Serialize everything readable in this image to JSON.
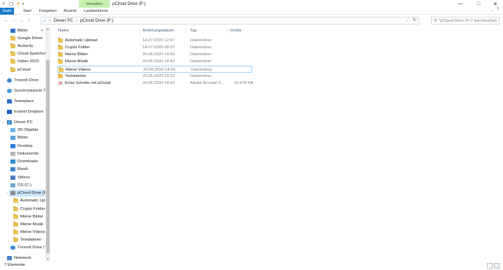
{
  "window": {
    "title": "pCloud Drive (P:)",
    "context_tab": "Verwalten",
    "controls": {
      "minimize": "—",
      "maximize": "□",
      "close": "✕"
    }
  },
  "ribbon": {
    "tabs": [
      "Datei",
      "Start",
      "Freigeben",
      "Ansicht",
      "Laufwerktools"
    ]
  },
  "address": {
    "crumbs": [
      "Dieser PC",
      "pCloud Drive (P:)"
    ],
    "search_placeholder": "\"pCloud Drive (P:)\" durchsuchen"
  },
  "nav": {
    "items": [
      {
        "label": "Bilder",
        "icon": "images-folder-icon",
        "pinned": true
      },
      {
        "label": "Google Drive",
        "icon": "folder-icon",
        "pinned": true
      },
      {
        "label": "Audacity",
        "icon": "folder-icon"
      },
      {
        "label": "Cloud-Speicher",
        "icon": "folder-icon"
      },
      {
        "label": "Indien 2020",
        "icon": "folder-icon"
      },
      {
        "label": "pCloud",
        "icon": "folder-icon"
      },
      {
        "label": "Tresorit Drive",
        "icon": "tresorit-icon"
      },
      {
        "label": "Synchronisierte Tr",
        "icon": "sync-icon"
      },
      {
        "label": "Teamplace",
        "icon": "teamplace-icon"
      },
      {
        "label": "trusted Dropbox",
        "icon": "dropbox-icon"
      },
      {
        "label": "Dieser PC",
        "icon": "pc-icon"
      },
      {
        "label": "3D-Objekte",
        "icon": "3d-objects-icon"
      },
      {
        "label": "Bilder",
        "icon": "images-folder-icon"
      },
      {
        "label": "Desktop",
        "icon": "desktop-icon"
      },
      {
        "label": "Dokumente",
        "icon": "documents-icon"
      },
      {
        "label": "Downloads",
        "icon": "downloads-icon"
      },
      {
        "label": "Musik",
        "icon": "music-icon"
      },
      {
        "label": "Videos",
        "icon": "videos-icon"
      },
      {
        "label": "OS (C:)",
        "icon": "drive-icon"
      },
      {
        "label": "pCloud Drive (P:)",
        "icon": "pcloud-drive-icon",
        "selected": true
      },
      {
        "label": "Automatic Uplo",
        "icon": "folder-icon"
      },
      {
        "label": "Crypto Folder",
        "icon": "folder-icon"
      },
      {
        "label": "Meine Bilder",
        "icon": "folder-icon"
      },
      {
        "label": "Meine Musik",
        "icon": "folder-icon"
      },
      {
        "label": "Meine Videos",
        "icon": "folder-icon"
      },
      {
        "label": "Testdateien",
        "icon": "folder-icon"
      },
      {
        "label": "Tresorit Drive (T:",
        "icon": "tresorit-drive-icon"
      },
      {
        "label": "Netzwerk",
        "icon": "network-icon"
      }
    ]
  },
  "columns": {
    "name": "Name",
    "date": "Änderungsdatum",
    "type": "Typ",
    "size": "Größe"
  },
  "files": [
    {
      "name": "Automatic Upload",
      "date": "14.07.2020 12:47",
      "type": "Dateiordner",
      "size": "",
      "icon": "folder-icon"
    },
    {
      "name": "Crypto Folder",
      "date": "14.07.2020 09:52",
      "type": "Dateiordner",
      "size": "",
      "icon": "folder-icon"
    },
    {
      "name": "Meine Bilder",
      "date": "24.06.2020 14:43",
      "type": "Dateiordner",
      "size": "",
      "icon": "folder-icon"
    },
    {
      "name": "Meine Musik",
      "date": "24.06.2020 14:43",
      "type": "Dateiordner",
      "size": "",
      "icon": "folder-icon"
    },
    {
      "name": "Meine Videos",
      "date": "24.06.2020 14:43",
      "type": "Dateiordner",
      "size": "",
      "icon": "folder-icon",
      "hover": true
    },
    {
      "name": "Testdateien",
      "date": "23.06.2020 13:23",
      "type": "Dateiordner",
      "size": "",
      "icon": "folder-icon"
    },
    {
      "name": "Erste Schritte mit pCloud",
      "date": "24.06.2020 14:43",
      "type": "Adobe Acrobat D...",
      "size": "24.678 KB",
      "icon": "pdf-file-icon"
    }
  ],
  "status": {
    "count": "7 Elemente"
  },
  "colors": {
    "accent": "#1979ca",
    "context_tab_bg": "#c6efb0",
    "selection": "#cce8ff",
    "folder": "#e8c154"
  }
}
